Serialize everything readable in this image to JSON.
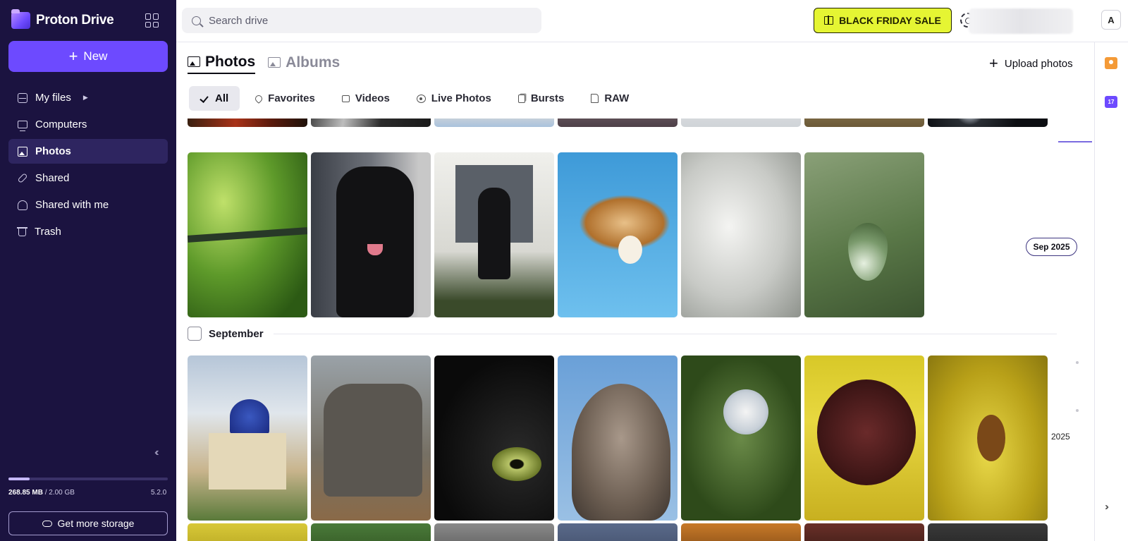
{
  "app": {
    "name": "Proton Drive"
  },
  "sidebar": {
    "new_label": "New",
    "items": [
      {
        "label": "My files",
        "icon": "drive-icon",
        "has_caret": true
      },
      {
        "label": "Computers",
        "icon": "computer-icon"
      },
      {
        "label": "Photos",
        "icon": "photo-icon",
        "active": true
      },
      {
        "label": "Shared",
        "icon": "link-icon"
      },
      {
        "label": "Shared with me",
        "icon": "people-icon"
      },
      {
        "label": "Trash",
        "icon": "trash-icon"
      }
    ],
    "storage": {
      "used": "268.85 MB",
      "separator": " / ",
      "total": "2.00 GB",
      "fraction": 0.131
    },
    "version": "5.2.0",
    "more_storage_label": "Get more storage"
  },
  "topbar": {
    "search_placeholder": "Search drive",
    "promo_label": "BLACK FRIDAY SALE",
    "promo_color": "#e5f533",
    "avatar_initial": "A"
  },
  "main": {
    "tabs": [
      {
        "label": "Photos",
        "active": true
      },
      {
        "label": "Albums",
        "active": false
      }
    ],
    "upload_label": "Upload photos",
    "filters": [
      {
        "label": "All",
        "active": true
      },
      {
        "label": "Favorites"
      },
      {
        "label": "Videos"
      },
      {
        "label": "Live Photos"
      },
      {
        "label": "Bursts"
      },
      {
        "label": "RAW"
      }
    ],
    "section_label": "September",
    "timeline": {
      "month_chip": "Sep 2025",
      "year": "2025"
    }
  },
  "rail": {
    "calendar_day": "17"
  },
  "colors": {
    "accent": "#6d4aff",
    "sidebar_bg": "#1b1340"
  }
}
